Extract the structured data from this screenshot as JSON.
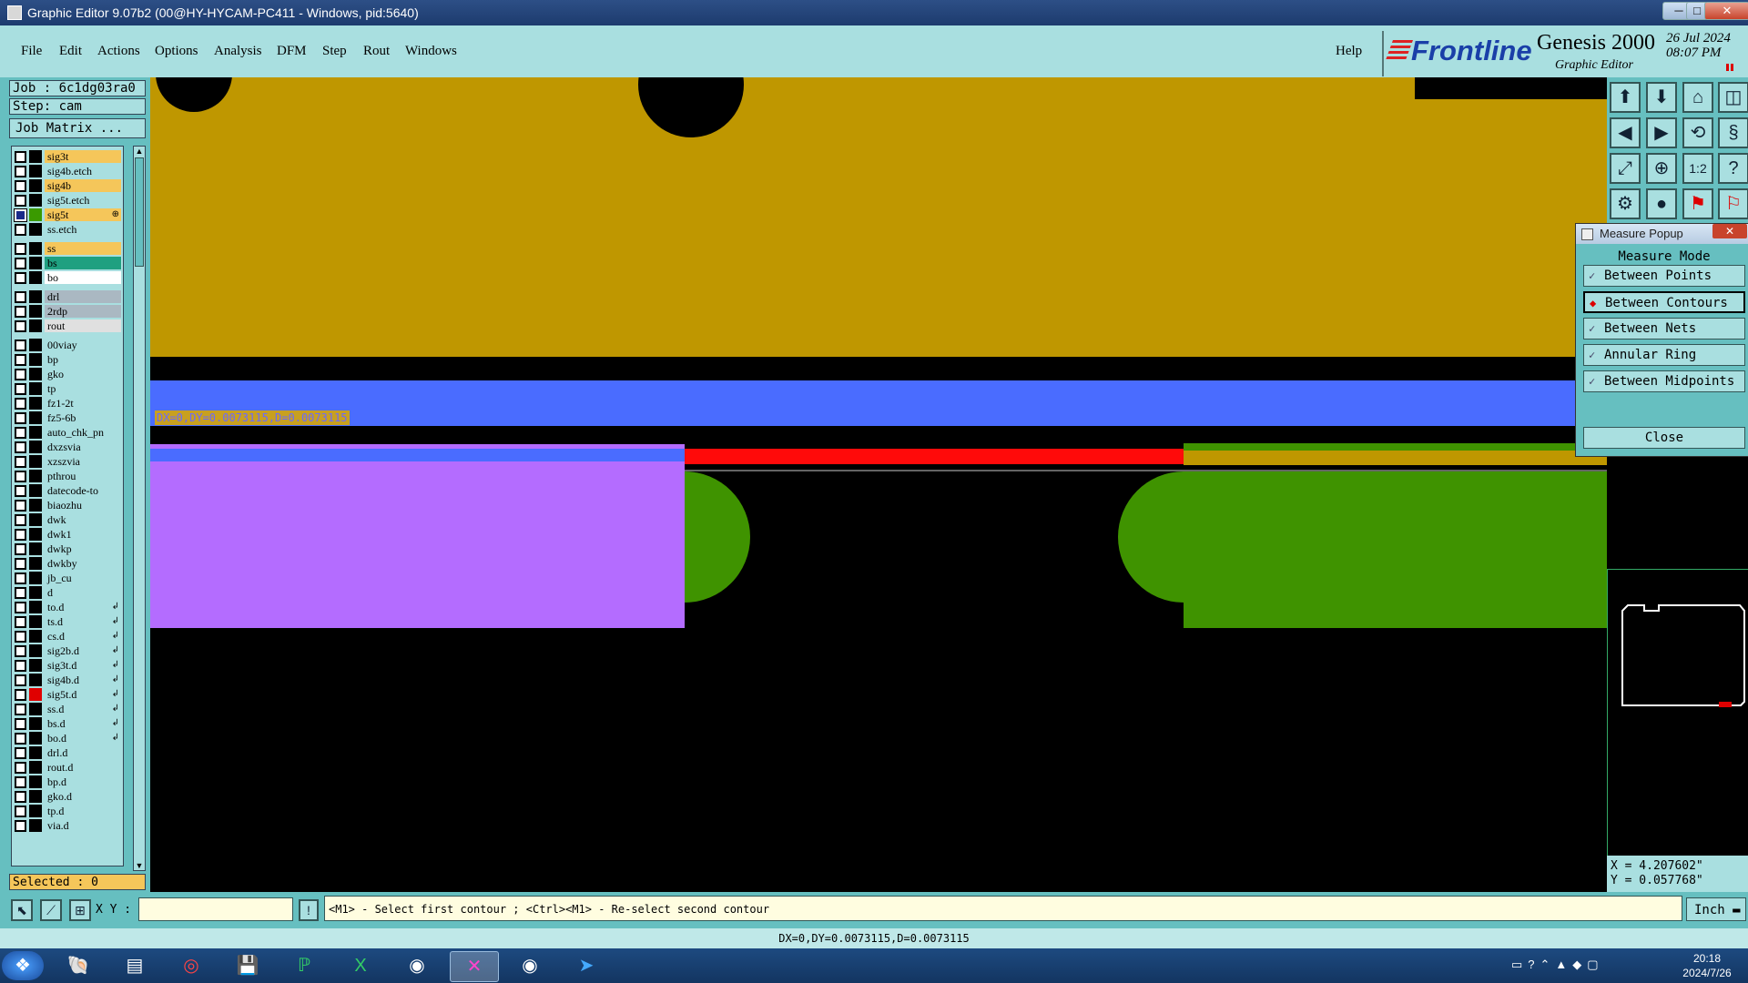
{
  "window": {
    "title": "Graphic Editor 9.07b2 (00@HY-HYCAM-PC411 - Windows, pid:5640)",
    "controls": [
      "─",
      "□",
      "✕"
    ]
  },
  "menu": {
    "items": [
      "File",
      "Edit",
      "Actions",
      "Options",
      "Analysis",
      "DFM",
      "Step",
      "Rout",
      "Windows"
    ],
    "help": "Help"
  },
  "brand": {
    "logo": "Frontline",
    "product": "Genesis 2000",
    "subtitle": "Graphic Editor",
    "date": "26 Jul 2024",
    "time": "08:07 PM"
  },
  "job": {
    "job_label": "Job : 6c1dg03ra0",
    "step_label": "Step: cam",
    "matrix_button": "Job Matrix ..."
  },
  "layers": [
    {
      "name": "sig3t",
      "color": "#f5c65a",
      "swatch": "#000000",
      "arrow": ""
    },
    {
      "name": "sig4b.etch",
      "color": "#a9dfe0",
      "swatch": "#000000",
      "arrow": ""
    },
    {
      "name": "sig4b",
      "color": "#f5c65a",
      "swatch": "#000000",
      "arrow": ""
    },
    {
      "name": "sig5t.etch",
      "color": "#a9dfe0",
      "swatch": "#000000",
      "arrow": ""
    },
    {
      "name": "sig5t",
      "color": "#f5c65a",
      "swatch": "#3a9a00",
      "arrow": "⊕",
      "active": true
    },
    {
      "name": "ss.etch",
      "color": "#a9dfe0",
      "swatch": "#000000",
      "arrow": ""
    },
    {
      "name": "ss",
      "color": "#f5c65a",
      "swatch": "#000000",
      "arrow": ""
    },
    {
      "name": "bs",
      "color": "#1fa080",
      "swatch": "#000000",
      "arrow": ""
    },
    {
      "name": "bo",
      "color": "#ffffff",
      "swatch": "#000000",
      "arrow": ""
    },
    {
      "name": "drl",
      "color": "#aab8c2",
      "swatch": "#000000",
      "arrow": ""
    },
    {
      "name": "2rdp",
      "color": "#aab8c2",
      "swatch": "#000000",
      "arrow": ""
    },
    {
      "name": "rout",
      "color": "#e0e0e0",
      "swatch": "#000000",
      "arrow": ""
    },
    {
      "name": "00viay",
      "color": "#a9dfe0",
      "swatch": "#000000",
      "arrow": ""
    },
    {
      "name": "bp",
      "color": "#a9dfe0",
      "swatch": "#000000",
      "arrow": ""
    },
    {
      "name": "gko",
      "color": "#a9dfe0",
      "swatch": "#000000",
      "arrow": ""
    },
    {
      "name": "tp",
      "color": "#a9dfe0",
      "swatch": "#000000",
      "arrow": ""
    },
    {
      "name": "fz1-2t",
      "color": "#a9dfe0",
      "swatch": "#000000",
      "arrow": ""
    },
    {
      "name": "fz5-6b",
      "color": "#a9dfe0",
      "swatch": "#000000",
      "arrow": ""
    },
    {
      "name": "auto_chk_pn",
      "color": "#a9dfe0",
      "swatch": "#000000",
      "arrow": ""
    },
    {
      "name": "dxzsvia",
      "color": "#a9dfe0",
      "swatch": "#000000",
      "arrow": ""
    },
    {
      "name": "xzszvia",
      "color": "#a9dfe0",
      "swatch": "#000000",
      "arrow": ""
    },
    {
      "name": "pthrou",
      "color": "#a9dfe0",
      "swatch": "#000000",
      "arrow": ""
    },
    {
      "name": "datecode-to",
      "color": "#a9dfe0",
      "swatch": "#000000",
      "arrow": ""
    },
    {
      "name": "biaozhu",
      "color": "#a9dfe0",
      "swatch": "#000000",
      "arrow": ""
    },
    {
      "name": "dwk",
      "color": "#a9dfe0",
      "swatch": "#000000",
      "arrow": ""
    },
    {
      "name": "dwk1",
      "color": "#a9dfe0",
      "swatch": "#000000",
      "arrow": ""
    },
    {
      "name": "dwkp",
      "color": "#a9dfe0",
      "swatch": "#000000",
      "arrow": ""
    },
    {
      "name": "dwkby",
      "color": "#a9dfe0",
      "swatch": "#000000",
      "arrow": ""
    },
    {
      "name": "jb_cu",
      "color": "#a9dfe0",
      "swatch": "#000000",
      "arrow": ""
    },
    {
      "name": "d",
      "color": "#a9dfe0",
      "swatch": "#000000",
      "arrow": ""
    },
    {
      "name": "to.d",
      "color": "#a9dfe0",
      "swatch": "#000000",
      "arrow": "↲"
    },
    {
      "name": "ts.d",
      "color": "#a9dfe0",
      "swatch": "#000000",
      "arrow": "↲"
    },
    {
      "name": "cs.d",
      "color": "#a9dfe0",
      "swatch": "#000000",
      "arrow": "↲"
    },
    {
      "name": "sig2b.d",
      "color": "#a9dfe0",
      "swatch": "#000000",
      "arrow": "↲"
    },
    {
      "name": "sig3t.d",
      "color": "#a9dfe0",
      "swatch": "#000000",
      "arrow": "↲"
    },
    {
      "name": "sig4b.d",
      "color": "#a9dfe0",
      "swatch": "#000000",
      "arrow": "↲"
    },
    {
      "name": "sig5t.d",
      "color": "#a9dfe0",
      "swatch": "#e00000",
      "arrow": "↲"
    },
    {
      "name": "ss.d",
      "color": "#a9dfe0",
      "swatch": "#000000",
      "arrow": "↲"
    },
    {
      "name": "bs.d",
      "color": "#a9dfe0",
      "swatch": "#000000",
      "arrow": "↲"
    },
    {
      "name": "bo.d",
      "color": "#a9dfe0",
      "swatch": "#000000",
      "arrow": "↲"
    },
    {
      "name": "drl.d",
      "color": "#a9dfe0",
      "swatch": "#000000",
      "arrow": ""
    },
    {
      "name": "rout.d",
      "color": "#a9dfe0",
      "swatch": "#000000",
      "arrow": ""
    },
    {
      "name": "bp.d",
      "color": "#a9dfe0",
      "swatch": "#000000",
      "arrow": ""
    },
    {
      "name": "gko.d",
      "color": "#a9dfe0",
      "swatch": "#000000",
      "arrow": ""
    },
    {
      "name": "tp.d",
      "color": "#a9dfe0",
      "swatch": "#000000",
      "arrow": ""
    },
    {
      "name": "via.d",
      "color": "#a9dfe0",
      "swatch": "#000000",
      "arrow": ""
    }
  ],
  "selected_label": "Selected : 0",
  "measure_label": "DX=0,DY=0.0073115,D=0.0073115",
  "popup": {
    "title": "Measure Popup",
    "heading": "Measure Mode",
    "options": [
      {
        "label": "Between Points",
        "selected": false
      },
      {
        "label": "Between Contours",
        "selected": true
      },
      {
        "label": "Between Nets",
        "selected": false
      },
      {
        "label": "Annular Ring",
        "selected": false
      },
      {
        "label": "Between Midpoints",
        "selected": false
      }
    ],
    "close": "Close"
  },
  "coords": {
    "x": "X = 4.207602\"",
    "y": "Y = 0.057768\""
  },
  "bottom": {
    "xy_label": "X Y :",
    "prompt": "<M1> - Select first contour ; <Ctrl><M1> - Re-select second contour",
    "units": "Inch",
    "status": "DX=0,DY=0.0073115,D=0.0073115"
  },
  "taskbar": {
    "time": "20:18",
    "date": "2024/7/26"
  },
  "colors": {
    "panel": "#66bfc0",
    "panel_light": "#a9dfe0",
    "copper": "#bf9700",
    "blue": "#4a6cff",
    "green": "#3f9300",
    "purple": "#b46cff",
    "red": "#ff0a0a"
  }
}
